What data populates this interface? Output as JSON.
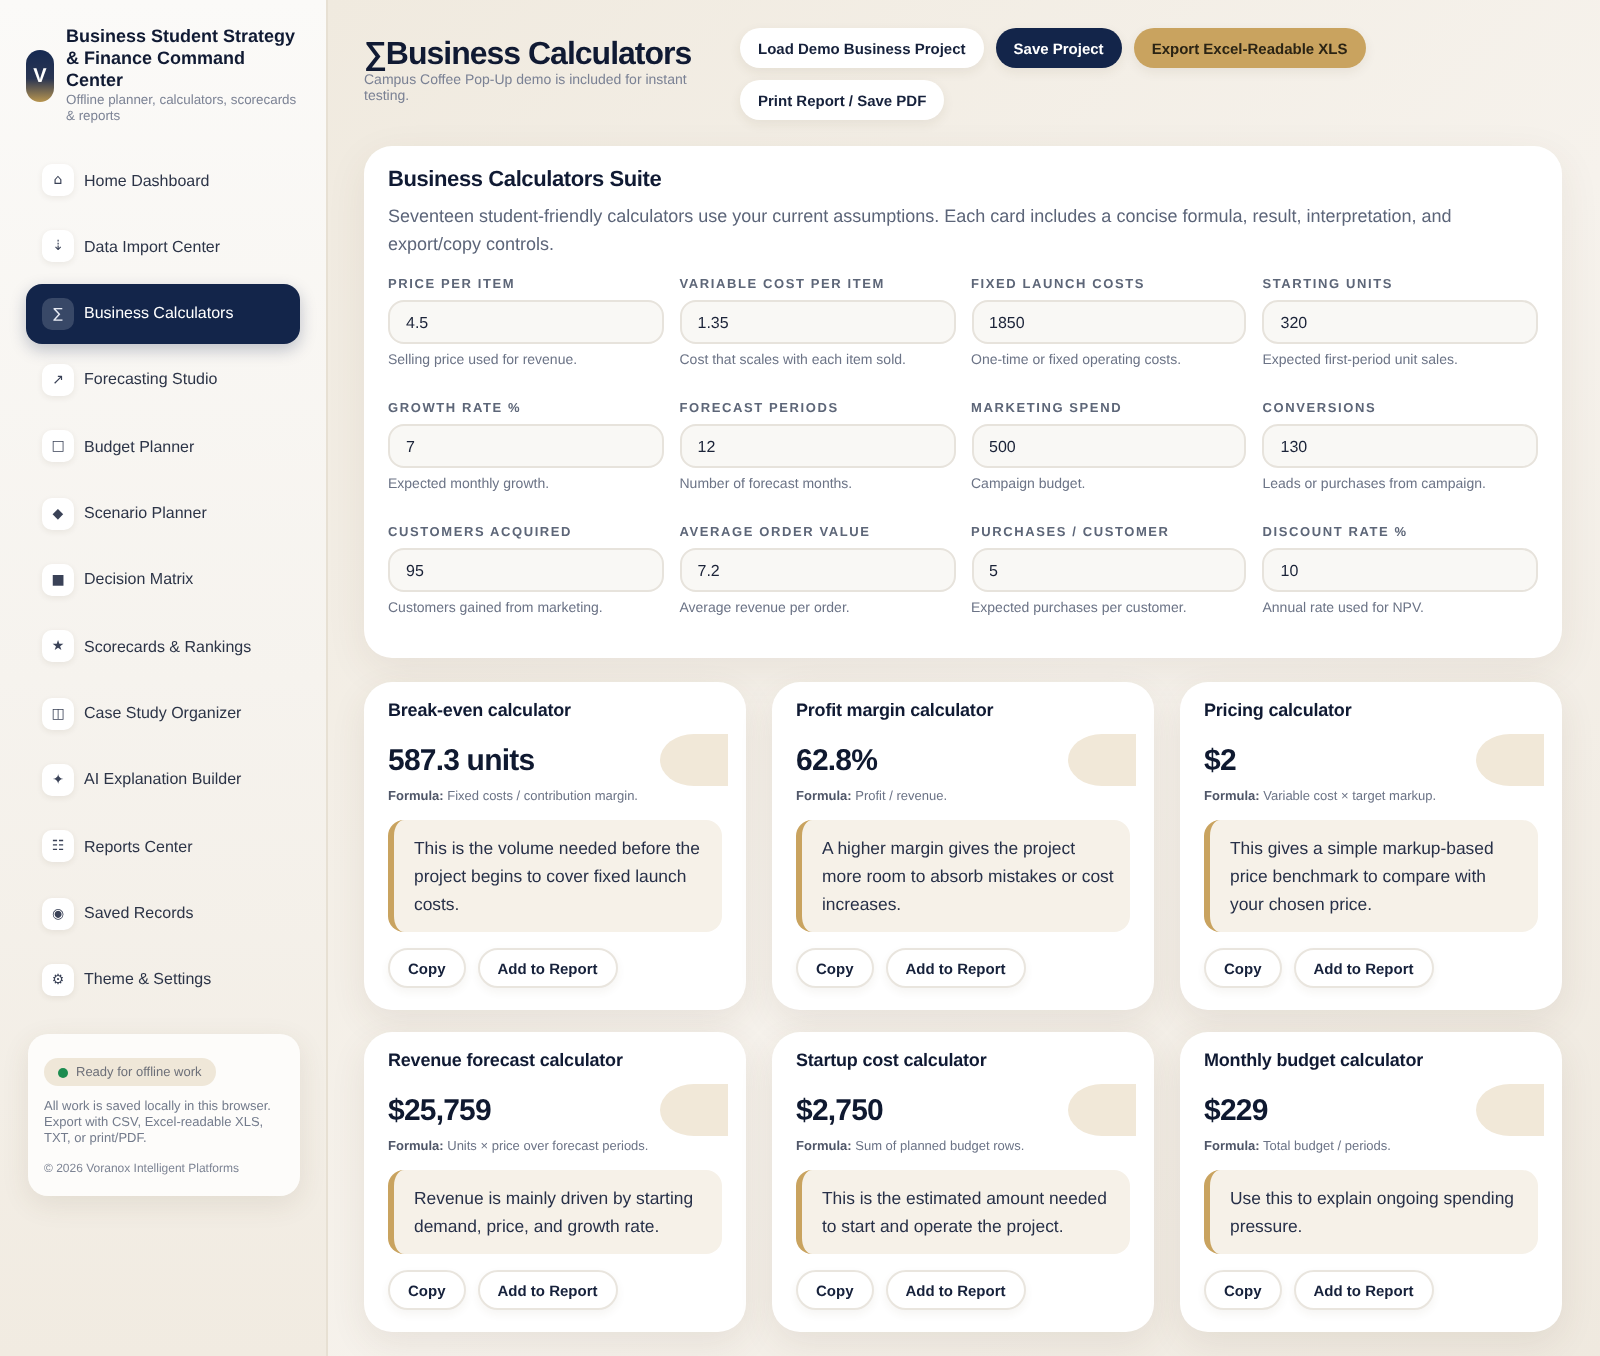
{
  "sidebar": {
    "brand": {
      "logo": "V",
      "title": "Business Student Strategy & Finance Command Center",
      "subtitle": "Offline planner, calculators, scorecards & reports"
    },
    "items": [
      {
        "icon": "⌂",
        "label": "Home Dashboard",
        "selected": false
      },
      {
        "icon": "⇣",
        "label": "Data Import Center",
        "selected": false
      },
      {
        "icon": "∑",
        "label": "Business Calculators",
        "selected": true
      },
      {
        "icon": "↗",
        "label": "Forecasting Studio",
        "selected": false
      },
      {
        "icon": "□",
        "label": "Budget Planner",
        "selected": false
      },
      {
        "icon": "◆",
        "label": "Scenario Planner",
        "selected": false
      },
      {
        "icon": "■",
        "label": "Decision Matrix",
        "selected": false
      },
      {
        "icon": "★",
        "label": "Scorecards & Rankings",
        "selected": false
      },
      {
        "icon": "◫",
        "label": "Case Study Organizer",
        "selected": false
      },
      {
        "icon": "✦",
        "label": "AI Explanation Builder",
        "selected": false
      },
      {
        "icon": "☷",
        "label": "Reports Center",
        "selected": false
      },
      {
        "icon": "◉",
        "label": "Saved Records",
        "selected": false
      },
      {
        "icon": "⚙",
        "label": "Theme & Settings",
        "selected": false
      }
    ],
    "status_card": {
      "badge": "Ready for offline work",
      "note": "All work is saved locally in this browser. Export with CSV, Excel-readable XLS, TXT, or print/PDF.",
      "copyright": "© 2026 Voranox Intelligent Platforms"
    }
  },
  "header": {
    "title": "∑Business Calculators",
    "subtitle": "Campus Coffee Pop-Up demo is included for instant testing.",
    "buttons": [
      {
        "label": "Load Demo Business Project",
        "kind": "plain"
      },
      {
        "label": "Save Project",
        "kind": "primary"
      },
      {
        "label": "Export Excel-Readable XLS",
        "kind": "accent"
      },
      {
        "label": "Print Report / Save PDF",
        "kind": "plain"
      }
    ]
  },
  "suite": {
    "title": "Business Calculators Suite",
    "description": "Seventeen student-friendly calculators use your current assumptions. Each card includes a concise formula, result, interpretation, and export/copy controls.",
    "fields": [
      {
        "label": "PRICE PER ITEM",
        "value": "4.5",
        "help": "Selling price used for revenue."
      },
      {
        "label": "VARIABLE COST PER ITEM",
        "value": "1.35",
        "help": "Cost that scales with each item sold."
      },
      {
        "label": "FIXED LAUNCH COSTS",
        "value": "1850",
        "help": "One-time or fixed operating costs."
      },
      {
        "label": "STARTING UNITS",
        "value": "320",
        "help": "Expected first-period unit sales."
      },
      {
        "label": "GROWTH RATE %",
        "value": "7",
        "help": "Expected monthly growth."
      },
      {
        "label": "FORECAST PERIODS",
        "value": "12",
        "help": "Number of forecast months."
      },
      {
        "label": "MARKETING SPEND",
        "value": "500",
        "help": "Campaign budget."
      },
      {
        "label": "CONVERSIONS",
        "value": "130",
        "help": "Leads or purchases from campaign."
      },
      {
        "label": "CUSTOMERS ACQUIRED",
        "value": "95",
        "help": "Customers gained from marketing."
      },
      {
        "label": "AVERAGE ORDER VALUE",
        "value": "7.2",
        "help": "Average revenue per order."
      },
      {
        "label": "PURCHASES / CUSTOMER",
        "value": "5",
        "help": "Expected purchases per customer."
      },
      {
        "label": "DISCOUNT RATE %",
        "value": "10",
        "help": "Annual rate used for NPV."
      }
    ]
  },
  "calculators": [
    {
      "title": "Break-even calculator",
      "result": "587.3 units",
      "formula": "**Formula:** Fixed costs / contribution margin.",
      "note": "This is the volume needed before the project begins to cover fixed launch costs.",
      "buttons": [
        "Copy",
        "Add to Report"
      ]
    },
    {
      "title": "Profit margin calculator",
      "result": "62.8%",
      "formula": "**Formula:** Profit / revenue.",
      "note": "A higher margin gives the project more room to absorb mistakes or cost increases.",
      "buttons": [
        "Copy",
        "Add to Report"
      ]
    },
    {
      "title": "Pricing calculator",
      "result": "$2",
      "formula": "**Formula:** Variable cost × target markup.",
      "note": "This gives a simple markup-based price benchmark to compare with your chosen price.",
      "buttons": [
        "Copy",
        "Add to Report"
      ]
    },
    {
      "title": "Revenue forecast calculator",
      "result": "$25,759",
      "formula": "**Formula:** Units × price over forecast periods.",
      "note": "Revenue is mainly driven by starting demand, price, and growth rate.",
      "buttons": [
        "Copy",
        "Add to Report"
      ]
    },
    {
      "title": "Startup cost calculator",
      "result": "$2,750",
      "formula": "**Formula:** Sum of planned budget rows.",
      "note": "This is the estimated amount needed to start and operate the project.",
      "buttons": [
        "Copy",
        "Add to Report"
      ]
    },
    {
      "title": "Monthly budget calculator",
      "result": "$229",
      "formula": "**Formula:** Total budget / periods.",
      "note": "Use this to explain ongoing spending pressure.",
      "buttons": [
        "Copy",
        "Add to Report"
      ]
    }
  ]
}
